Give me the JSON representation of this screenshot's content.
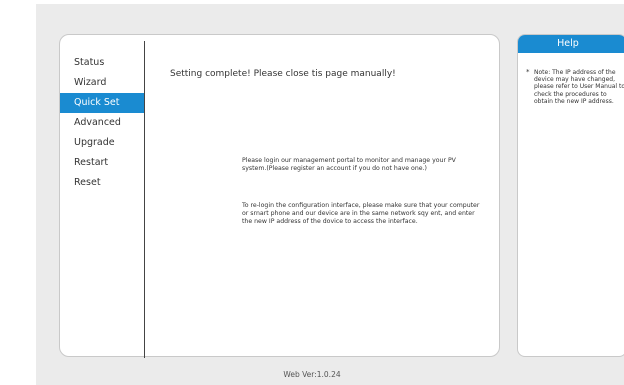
{
  "menu": {
    "items": [
      {
        "label": "Status",
        "active": false
      },
      {
        "label": "Wizard",
        "active": false
      },
      {
        "label": "Quick Set",
        "active": true
      },
      {
        "label": "Advanced",
        "active": false
      },
      {
        "label": "Upgrade",
        "active": false
      },
      {
        "label": "Restart",
        "active": false
      },
      {
        "label": "Reset",
        "active": false
      }
    ]
  },
  "main": {
    "complete_text": "Setting complete! Please close tis page manually!",
    "message1": "Please login our management portal to monitor and manage your PV system.(Please register an account if you do not have one.)",
    "message2": "To re-login the configuration interface, please make sure that your computer or srnart phone and our device are in the same network sqy ent, and enter the new IP address of the dovice to access the interface."
  },
  "help": {
    "title": "Help",
    "star": "*",
    "note": "Note: The IP address of the device may have changed, please refer to User Manual to check the procedures to obtain the new IP address."
  },
  "footer": {
    "version": "Web Ver:1.0.24"
  },
  "colors": {
    "accent": "#1a8bd1",
    "background": "#ebebeb"
  }
}
